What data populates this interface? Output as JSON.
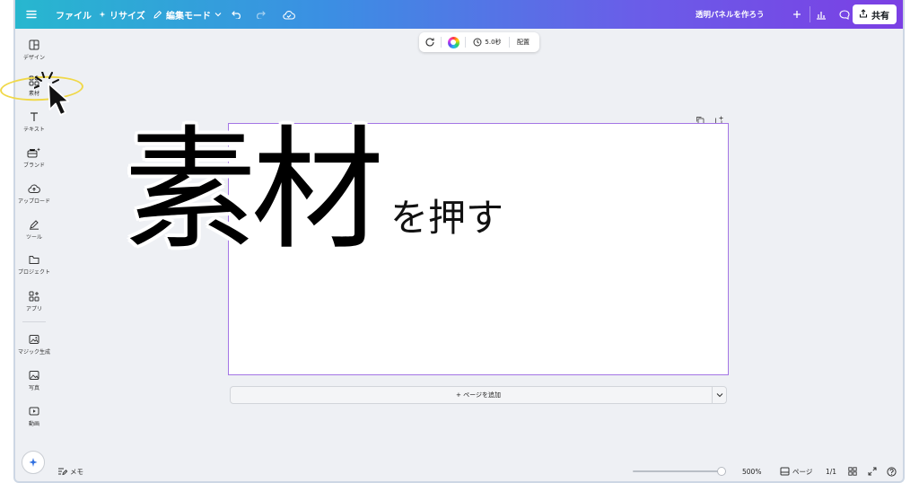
{
  "topbar": {
    "file_label": "ファイル",
    "resize_label": "リサイズ",
    "edit_mode_label": "編集モード",
    "doc_title": "透明パネルを作ろう",
    "share_label": "共有"
  },
  "sidebar": {
    "items": [
      {
        "label": "デザイン",
        "icon": "design-icon"
      },
      {
        "label": "素材",
        "icon": "elements-icon"
      },
      {
        "label": "テキスト",
        "icon": "text-icon"
      },
      {
        "label": "ブランド",
        "icon": "brand-icon"
      },
      {
        "label": "アップロード",
        "icon": "upload-icon"
      },
      {
        "label": "ツール",
        "icon": "tools-icon"
      },
      {
        "label": "プロジェクト",
        "icon": "folder-icon"
      },
      {
        "label": "アプリ",
        "icon": "apps-icon"
      },
      {
        "label": "マジック生成",
        "icon": "magic-media-icon"
      },
      {
        "label": "写真",
        "icon": "photo-icon"
      },
      {
        "label": "動画",
        "icon": "video-icon"
      }
    ]
  },
  "float_toolbar": {
    "duration": "5.0秒",
    "arrange_label": "配置"
  },
  "canvas": {
    "add_page_label": "+ ページを追加"
  },
  "bottom": {
    "notes_label": "メモ",
    "zoom": "500%",
    "zoom_level": 0.95,
    "pages_label": "ページ",
    "page_count": "1/1"
  },
  "annotation": {
    "big_text": "素材",
    "sub_text": "を押す",
    "highlight_color": "#f0d848"
  },
  "colors": {
    "accent_gradient_start": "#27b7cf",
    "accent_gradient_end": "#7b3fe4",
    "selection_border": "#a476e5"
  }
}
